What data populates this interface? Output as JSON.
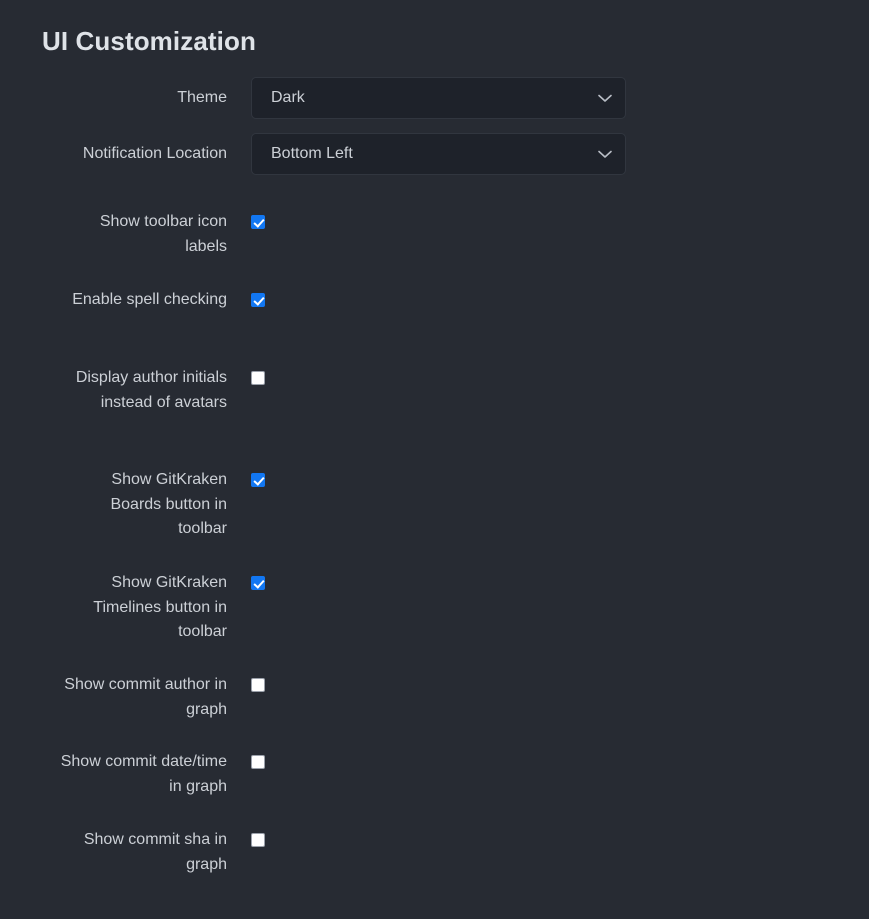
{
  "section": {
    "title": "UI Customization"
  },
  "selects": [
    {
      "label": "Theme",
      "value": "Dark",
      "name": "theme",
      "options": [
        "Dark"
      ]
    },
    {
      "label": "Notification Location",
      "value": "Bottom Left",
      "name": "notification-location",
      "options": [
        "Bottom Left"
      ]
    }
  ],
  "checkboxes": [
    {
      "label": "Show toolbar icon labels",
      "checked": true,
      "name": "show-toolbar-icon-labels"
    },
    {
      "label": "Enable spell checking",
      "checked": true,
      "name": "enable-spell-checking"
    },
    {
      "label": "Display author initials instead of avatars",
      "checked": false,
      "name": "display-author-initials"
    },
    {
      "label": "Show GitKraken Boards button in toolbar",
      "checked": true,
      "name": "show-gitkraken-boards-button"
    },
    {
      "label": "Show GitKraken Timelines button in toolbar",
      "checked": true,
      "name": "show-gitkraken-timelines-button"
    },
    {
      "label": "Show commit author in graph",
      "checked": false,
      "name": "show-commit-author-in-graph"
    },
    {
      "label": "Show commit date/time in graph",
      "checked": false,
      "name": "show-commit-datetime-in-graph"
    },
    {
      "label": "Show commit sha in graph",
      "checked": false,
      "name": "show-commit-sha-in-graph"
    }
  ],
  "colors": {
    "background": "#272b33",
    "field_background": "#1e222a",
    "field_border": "#31363f",
    "text": "#ccd0d6",
    "heading": "#dfe3e8",
    "checkbox_accent": "#1277f2"
  },
  "icons": {
    "chevron_down": "chevron-down-icon"
  }
}
